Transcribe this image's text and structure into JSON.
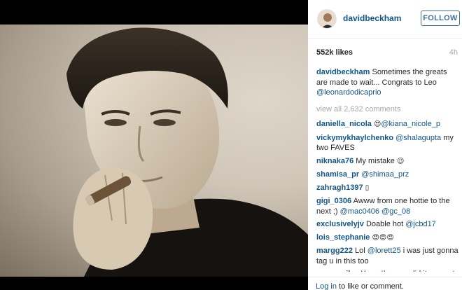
{
  "post": {
    "author": "davidbeckham",
    "follow_label": "FOLLOW",
    "likes": "552k likes",
    "time_ago": "4h",
    "caption_text": " Sometimes the greats are made to wait... Congrats to Leo ",
    "caption_mention": "@leonardodicaprio",
    "view_all": "view all 2,632 comments"
  },
  "comments": [
    {
      "user": "daniella_nicola",
      "pre": " ",
      "emoji": "😍",
      "mention": "@kiana_nicole_p",
      "post": ""
    },
    {
      "user": "vickymykhaylchenko",
      "pre": " ",
      "mention": "@shalagupta",
      "post": " my two FAVES"
    },
    {
      "user": "niknaka76",
      "pre": " My mistake ",
      "emoji": "😉",
      "post": ""
    },
    {
      "user": "shamisa_pr",
      "pre": " ",
      "mention": "@shimaa_prz",
      "post": ""
    },
    {
      "user": "zahragh1397",
      "pre": " ",
      "emoji": "▯",
      "post": ""
    },
    {
      "user": "gigi_0306",
      "pre": " Awww from one hottie to the next ;) ",
      "mention": "@mac0406",
      "post": " ",
      "mention2": "@gc_08"
    },
    {
      "user": "exclusivelyjv",
      "pre": " Doable hot ",
      "mention": "@jcbd17",
      "post": ""
    },
    {
      "user": "lois_stephanie",
      "pre": " ",
      "emoji": "😍😍😍",
      "post": ""
    },
    {
      "user": "margg222",
      "pre": " Lol ",
      "mention": "@lorett25",
      "post": " i was just gonna tag u in this too"
    },
    {
      "user": "rymasmilee",
      "pre": " Yess ",
      "mention": "#leo",
      "post": " you did it congrats ",
      "emoji2": "😊"
    }
  ],
  "footer": {
    "login_link": "Log in",
    "login_rest": " to like or comment."
  },
  "colors": {
    "link": "#125688",
    "follow": "#3f729b",
    "muted": "#a5a7aa"
  }
}
